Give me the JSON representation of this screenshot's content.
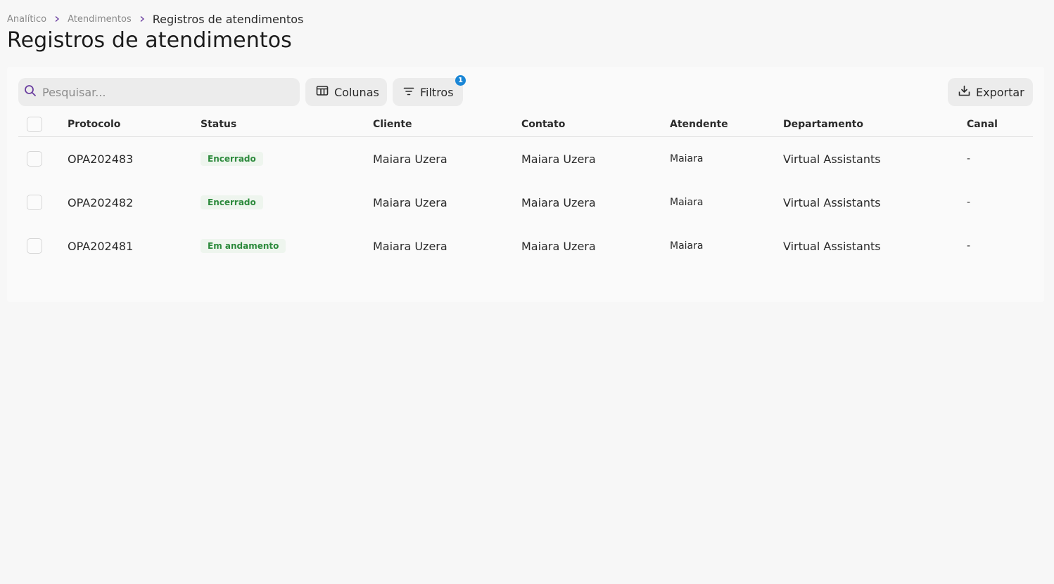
{
  "breadcrumb": {
    "items": [
      "Analítico",
      "Atendimentos"
    ],
    "current": "Registros de atendimentos"
  },
  "page": {
    "title": "Registros de atendimentos"
  },
  "toolbar": {
    "search_placeholder": "Pesquisar...",
    "columns_label": "Colunas",
    "filters_label": "Filtros",
    "filters_count": "1",
    "export_label": "Exportar"
  },
  "table": {
    "headers": {
      "protocol": "Protocolo",
      "status": "Status",
      "client": "Cliente",
      "contact": "Contato",
      "agent": "Atendente",
      "department": "Departamento",
      "channel": "Canal"
    },
    "rows": [
      {
        "protocol": "OPA202483",
        "status": "Encerrado",
        "client": "Maiara Uzera",
        "contact": "Maiara Uzera",
        "agent": "Maiara",
        "department": "Virtual Assistants",
        "channel": "-"
      },
      {
        "protocol": "OPA202482",
        "status": "Encerrado",
        "client": "Maiara Uzera",
        "contact": "Maiara Uzera",
        "agent": "Maiara",
        "department": "Virtual Assistants",
        "channel": "-"
      },
      {
        "protocol": "OPA202481",
        "status": "Em andamento",
        "client": "Maiara Uzera",
        "contact": "Maiara Uzera",
        "agent": "Maiara",
        "department": "Virtual Assistants",
        "channel": "-"
      }
    ]
  },
  "colors": {
    "accent": "#6b3fa0",
    "status_green": "#2c8a3c",
    "badge_blue": "#1a86d6"
  }
}
